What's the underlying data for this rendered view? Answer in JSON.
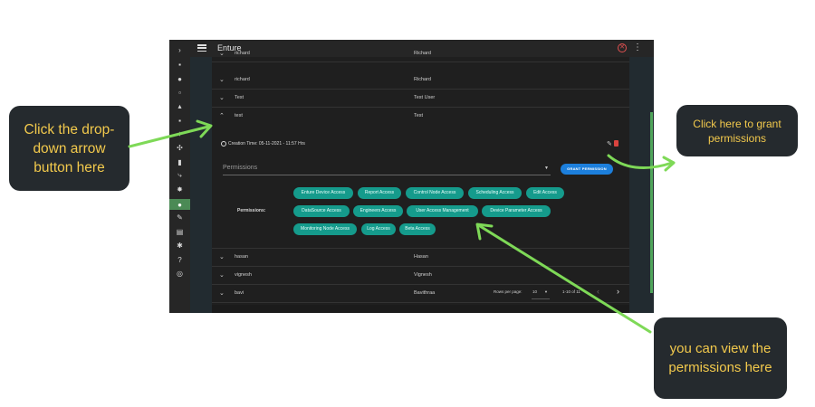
{
  "app": {
    "title": "Enture",
    "rail_expand": "›",
    "kebab": "⋮"
  },
  "table": {
    "top_partial": {
      "c1": "richard",
      "c2": "Richard"
    },
    "rows_above": [
      {
        "name": "richard",
        "display": "Richard"
      },
      {
        "name": "Test",
        "display": "Test User"
      },
      {
        "name": "test",
        "display": "Test"
      }
    ],
    "expanded": {
      "creation_time": "Creation Time: 05-11-2021 - 11:57 Hrs",
      "permissions_placeholder": "Permissions",
      "grant_button": "GRANT PERMISSION",
      "permissions_label": "Permissions:",
      "chips": [
        "Enture Device Access",
        "Report Access",
        "Control Node Access",
        "Scheduling Access",
        "Edit Access",
        "DataSource Access",
        "Engineers Access",
        "User Access Management",
        "Device Parameter Access",
        "Monitoring Node Access",
        "Log Access",
        "Beta Access"
      ]
    },
    "rows_below": [
      {
        "name": "hasan",
        "display": "Hasan"
      },
      {
        "name": "vignesh",
        "display": "Vignesh"
      },
      {
        "name": "bavi",
        "display": "Bavithraa"
      }
    ],
    "footer": {
      "rows_per_page_label": "Rows per page:",
      "rows_per_page_value": "10",
      "range": "1-10 of 11"
    }
  },
  "callouts": {
    "dropdown": "Click the drop-down arrow button here",
    "grant": "Click here to grant permissions",
    "view": "you can view the permissions here"
  },
  "colors": {
    "chip": "#159b8c",
    "grant_button": "#1c7fdc",
    "callout_text": "#f2c94c",
    "callout_bg": "#252a2e",
    "arrow": "#7ed957"
  }
}
